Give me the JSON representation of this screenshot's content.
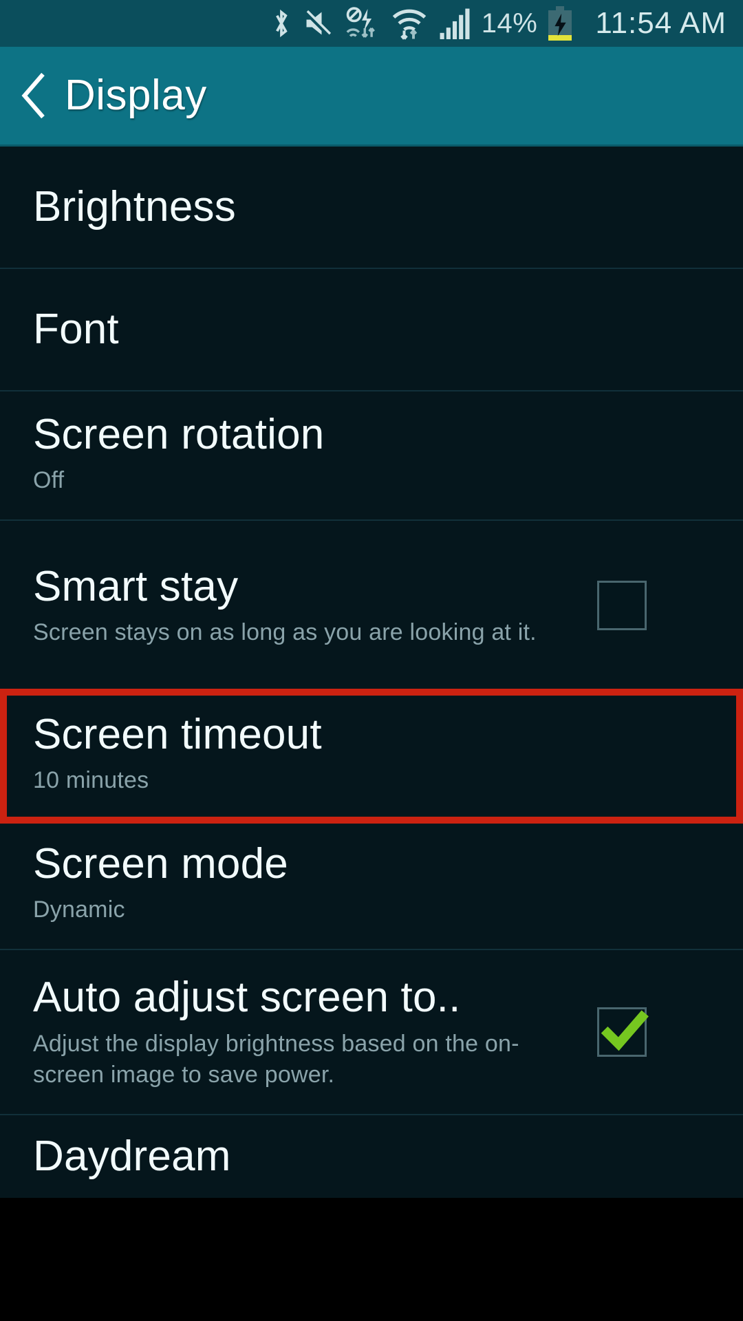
{
  "statusbar": {
    "battery_percent": "14%",
    "clock": "11:54 AM",
    "icons": [
      "bluetooth-icon",
      "sound-mute-icon",
      "no-sim-icon",
      "wifi-icon",
      "signal-bars-icon",
      "battery-charging-icon"
    ]
  },
  "actionbar": {
    "back_label": "back-chevron",
    "title": "Display"
  },
  "list": {
    "items": [
      {
        "title": "Brightness",
        "subtitle": "",
        "checkbox": null
      },
      {
        "title": "Font",
        "subtitle": "",
        "checkbox": null
      },
      {
        "title": "Screen rotation",
        "subtitle": "Off",
        "checkbox": null
      },
      {
        "title": "Smart stay",
        "subtitle": "Screen stays on as long as you are looking at it.",
        "checkbox": "unchecked"
      },
      {
        "title": "Screen timeout",
        "subtitle": "10 minutes",
        "checkbox": null
      },
      {
        "title": "Screen mode",
        "subtitle": "Dynamic",
        "checkbox": null
      },
      {
        "title": "Auto adjust screen to..",
        "subtitle": "Adjust the display brightness based on the on-screen image to save power.",
        "checkbox": "checked"
      },
      {
        "title": "Daydream",
        "subtitle": "",
        "checkbox": null
      }
    ]
  },
  "highlight": {
    "target": "Screen timeout",
    "color": "#cc2211"
  },
  "colors": {
    "statusbar_bg": "#0b4e5c",
    "actionbar_bg": "#0d7385",
    "list_bg": "#05161c",
    "divider": "#11303a",
    "title_text": "#f2fbfc",
    "subtitle_text": "#8aa3aa",
    "check_green": "#76c720",
    "battery_fill": "#e3e33a"
  }
}
